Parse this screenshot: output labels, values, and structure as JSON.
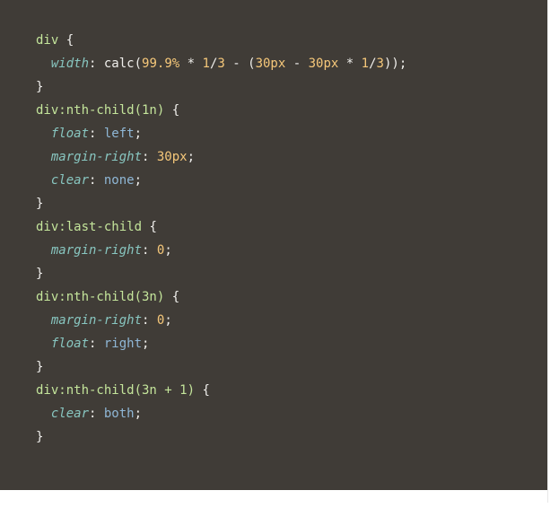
{
  "code": {
    "rules": [
      {
        "selector": "div",
        "declarations": [
          {
            "property": "width",
            "value_expr": "calc(99.9% * 1/3 - (30px - 30px * 1/3))"
          }
        ]
      },
      {
        "selector": "div:nth-child(1n)",
        "declarations": [
          {
            "property": "float",
            "value_expr": "left"
          },
          {
            "property": "margin-right",
            "value_expr": "30px"
          },
          {
            "property": "clear",
            "value_expr": "none"
          }
        ]
      },
      {
        "selector": "div:last-child",
        "declarations": [
          {
            "property": "margin-right",
            "value_expr": "0"
          }
        ]
      },
      {
        "selector": "div:nth-child(3n)",
        "declarations": [
          {
            "property": "margin-right",
            "value_expr": "0"
          },
          {
            "property": "float",
            "value_expr": "right"
          }
        ]
      },
      {
        "selector": "div:nth-child(3n + 1)",
        "declarations": [
          {
            "property": "clear",
            "value_expr": "both"
          }
        ]
      }
    ],
    "keyword_values": [
      "left",
      "right",
      "none",
      "both"
    ],
    "indent": "  "
  }
}
